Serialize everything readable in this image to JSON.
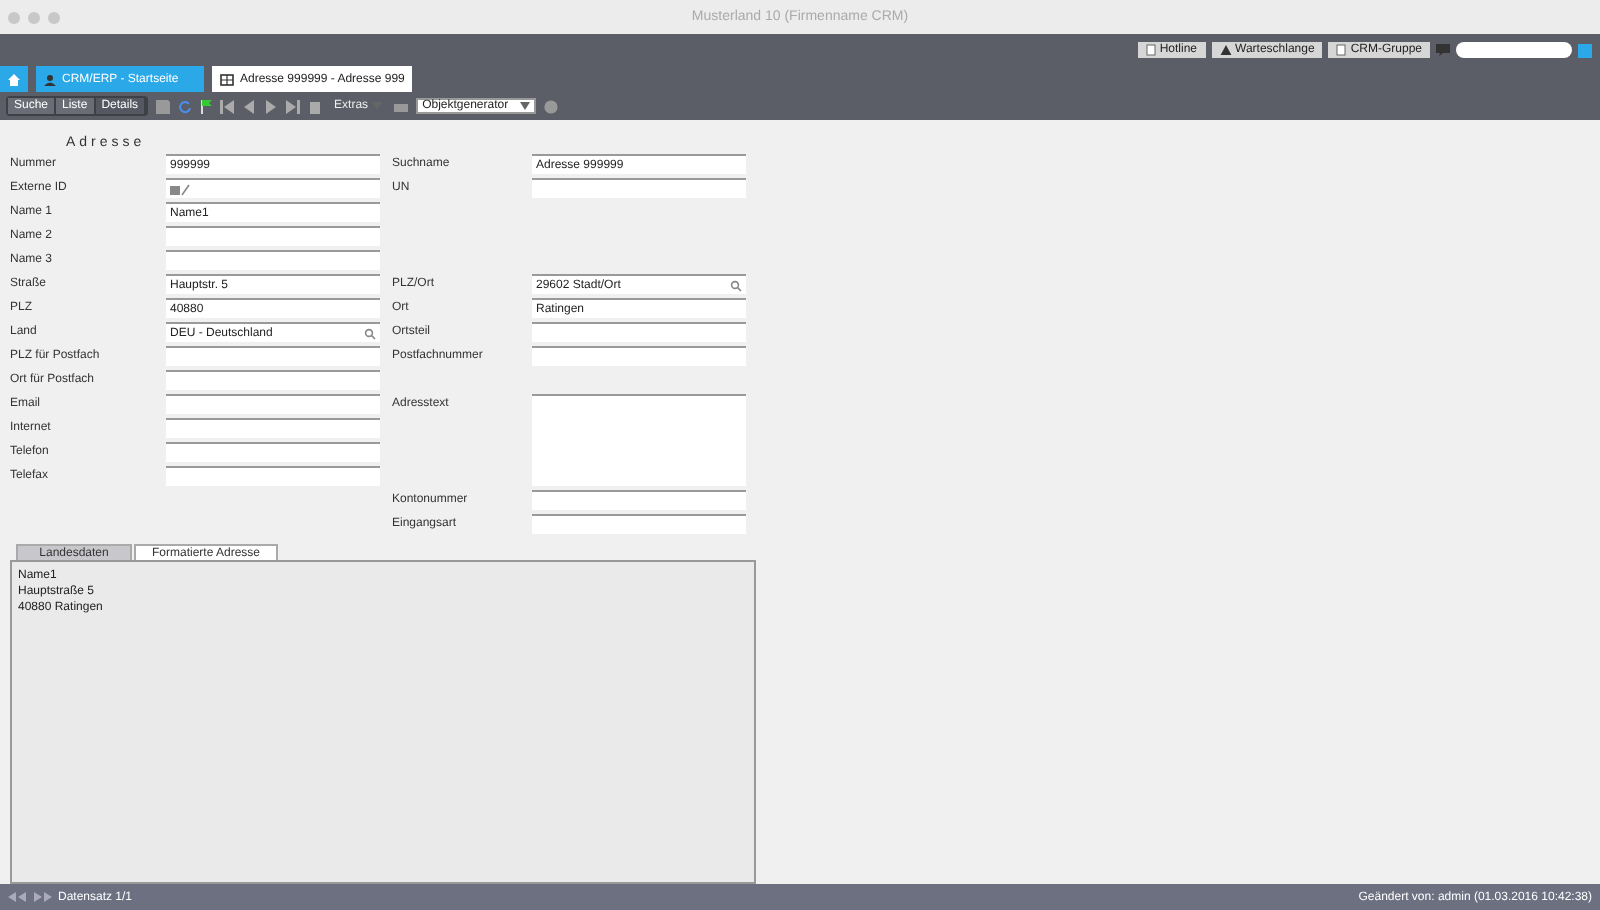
{
  "window": {
    "title": "Musterland 10 (Firmenname CRM)"
  },
  "top_links": [
    {
      "label": "Hotline",
      "kind": "doc"
    },
    {
      "label": "Warteschlange",
      "kind": "warn"
    },
    {
      "label": "CRM-Gruppe",
      "kind": "doc"
    }
  ],
  "tabs": [
    {
      "label": "CRM/ERP - Startseite",
      "kind": "person",
      "selected": false
    },
    {
      "label": "Adresse 999999 - Adresse 999",
      "kind": "grid",
      "selected": true
    }
  ],
  "breadcrumb": [
    {
      "label": "Suche",
      "selected": false
    },
    {
      "label": "Liste",
      "selected": false
    },
    {
      "label": "Details",
      "selected": true
    }
  ],
  "toolbar": {
    "extras": "Extras",
    "generator": "Objektgenerator"
  },
  "section": "Adresse",
  "left_fields": [
    {
      "label": "Nummer",
      "value": "999999",
      "kind": "text"
    },
    {
      "label": "Externe ID",
      "kind": "folder"
    },
    {
      "label": "Name 1",
      "value": "Name1",
      "kind": "text"
    },
    {
      "label": "Name 2",
      "kind": "text"
    },
    {
      "label": "Name 3",
      "kind": "text"
    },
    {
      "label": "Straße",
      "value": "Hauptstr. 5",
      "kind": "text"
    },
    {
      "label": "PLZ",
      "value": "40880",
      "kind": "text"
    },
    {
      "label": "Land",
      "value": "DEU - Deutschland",
      "kind": "lookup"
    },
    {
      "label": "PLZ für Postfach",
      "kind": "text"
    },
    {
      "label": "Ort für Postfach",
      "kind": "text"
    },
    {
      "label": "Email",
      "kind": "text"
    },
    {
      "label": "Internet",
      "kind": "text"
    },
    {
      "label": "Telefon",
      "kind": "text"
    },
    {
      "label": "Telefax",
      "kind": "text"
    }
  ],
  "right_fields": [
    {
      "label": "Suchname",
      "value": "Adresse 999999",
      "kind": "text"
    },
    {
      "label": "UN",
      "kind": "text"
    },
    {
      "label": "PLZ/Ort",
      "value": "29602 Stadt/Ort",
      "kind": "lookup"
    },
    {
      "label": "Ort",
      "value": "Ratingen",
      "kind": "text"
    },
    {
      "label": "Ortsteil",
      "kind": "text"
    },
    {
      "label": "Postfachnummer",
      "kind": "text"
    },
    {
      "label": "Adresstext",
      "kind": "textarea"
    },
    {
      "label": "Kontonummer",
      "kind": "text"
    },
    {
      "label": "Eingangsart",
      "kind": "text"
    }
  ],
  "bottom_tabs": [
    {
      "label": "Landesdaten",
      "selected": false
    },
    {
      "label": "Formatierte Adresse",
      "selected": true
    }
  ],
  "formatted_address": [
    "Name1",
    "Hauptstraße 5",
    "40880 Ratingen"
  ],
  "status_bar": {
    "record": "Datensatz 1/1",
    "changed": "Geändert von: admin (01.03.2016 10:42:38)"
  }
}
